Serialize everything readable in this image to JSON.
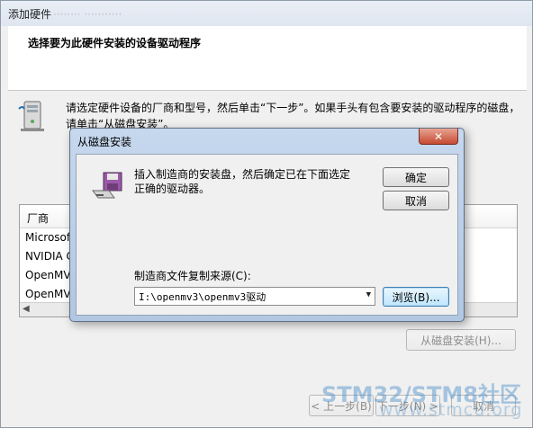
{
  "window": {
    "title": "添加硬件",
    "title_blurred": "········  ···········"
  },
  "wizard": {
    "heading": "选择要为此硬件安装的设备驱动程序",
    "instruction": "请选定硬件设备的厂商和型号，然后单击“下一步”。如果手头有包含要安装的驱动程序的磁盘，请单击“从磁盘安装”。",
    "list": {
      "column_header": "厂商",
      "rows": [
        "Microsoft",
        "NVIDIA C",
        "OpenMV",
        "OpenMV"
      ]
    },
    "have_disk_button": "从磁盘安装(H)...",
    "back_button": "< 上一步(B)",
    "next_button": "下一步(N) >",
    "cancel_button": "取消"
  },
  "dialog": {
    "title": "从磁盘安装",
    "close_glyph": "✕",
    "message": "插入制造商的安装盘，然后确定已在下面选定正确的驱动器。",
    "ok_button": "确定",
    "cancel_button": "取消",
    "source_label": "制造商文件复制来源(C):",
    "source_value": "I:\\openmv3\\openmv3驱动",
    "browse_button": "浏览(B)..."
  },
  "watermark": {
    "main": "STM32/STM8社区",
    "sub": "www.stmcu.org"
  },
  "icons": [
    "computer-tower-icon",
    "install-disk-icon",
    "close-icon",
    "dropdown-arrow-icon",
    "scroll-left-icon"
  ]
}
